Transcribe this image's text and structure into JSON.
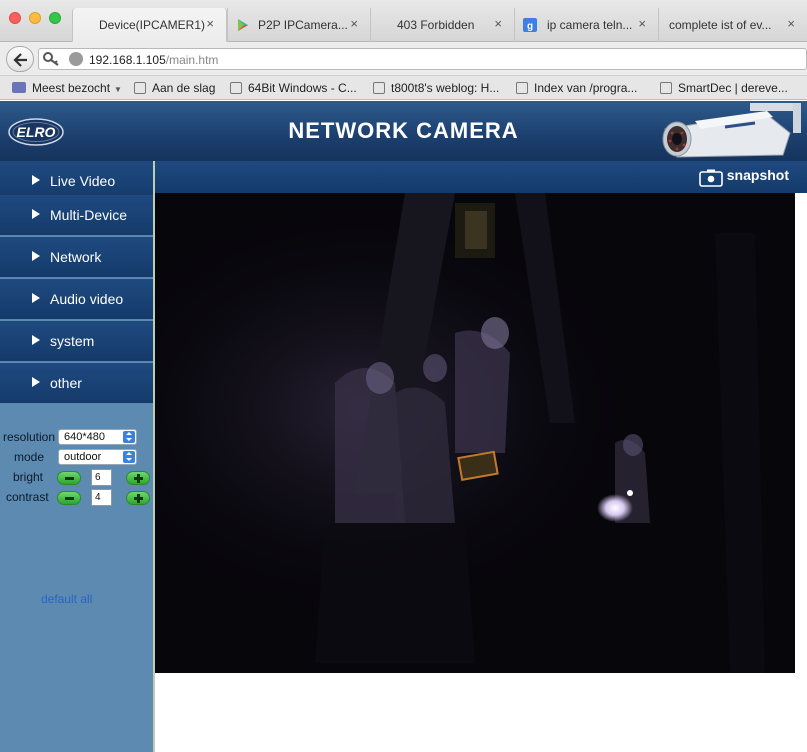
{
  "browser": {
    "tabs": [
      {
        "title": "Device(IPCAMER1)",
        "close": "×"
      },
      {
        "title": "P2P IPCamera...",
        "close": "×"
      },
      {
        "title": "403 Forbidden",
        "close": "×"
      },
      {
        "title": "ip camera teln...",
        "close": "×"
      },
      {
        "title": "complete ist of ev...",
        "close": "×"
      }
    ],
    "url_host": "192.168.1.105",
    "url_path": "/main.htm",
    "bookmarks": [
      {
        "label": "Meest bezocht"
      },
      {
        "label": "Aan de slag"
      },
      {
        "label": "64Bit Windows - C..."
      },
      {
        "label": "t800t8's weblog: H..."
      },
      {
        "label": "Index van /progra..."
      },
      {
        "label": "SmartDec | dereve..."
      }
    ]
  },
  "header": {
    "logo": "ELRO",
    "title": "NETWORK CAMERA"
  },
  "menu": [
    {
      "label": "Live Video"
    },
    {
      "label": "Multi-Device"
    },
    {
      "label": "Network"
    },
    {
      "label": "Audio video"
    },
    {
      "label": "system"
    },
    {
      "label": "other"
    }
  ],
  "controls": {
    "resolution_label": "resolution",
    "resolution_value": "640*480",
    "mode_label": "mode",
    "mode_value": "outdoor",
    "bright_label": "bright",
    "bright_value": "6",
    "contrast_label": "contrast",
    "contrast_value": "4",
    "default_all": "default all"
  },
  "video": {
    "snapshot_label": "snapshot"
  }
}
